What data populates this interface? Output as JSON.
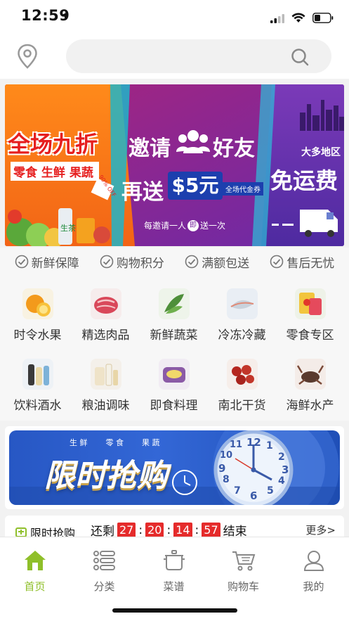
{
  "status_bar": {
    "time": "12:59"
  },
  "header": {
    "search": {
      "placeholder": ""
    }
  },
  "banner": {
    "left_title": "全场九折",
    "left_tags": "零食 生鲜 果蔬",
    "left_ribbon": "90% OFF",
    "product_label": "生茶",
    "center_invite": "邀请",
    "center_friends": "好友",
    "center_again": "再送",
    "center_amount": "$5元",
    "center_coupon": "全场代金券",
    "center_rule_a": "每邀请一人",
    "center_rule_b": "即",
    "center_rule_c": "送一次",
    "right_region": "大多地区",
    "right_free": "免运费"
  },
  "guarantees": [
    "新鲜保障",
    "购物积分",
    "满额包送",
    "售后无忧"
  ],
  "categories": [
    {
      "label": "时令水果",
      "icon": "fruit-icon"
    },
    {
      "label": "精选肉品",
      "icon": "meat-icon"
    },
    {
      "label": "新鲜蔬菜",
      "icon": "vegetable-icon"
    },
    {
      "label": "冷冻冷藏",
      "icon": "frozen-icon"
    },
    {
      "label": "零食专区",
      "icon": "snack-icon"
    },
    {
      "label": "饮料酒水",
      "icon": "drinks-icon"
    },
    {
      "label": "粮油调味",
      "icon": "grain-oil-icon"
    },
    {
      "label": "即食料理",
      "icon": "ready-meal-icon"
    },
    {
      "label": "南北干货",
      "icon": "dried-goods-icon"
    },
    {
      "label": "海鲜水产",
      "icon": "seafood-icon"
    }
  ],
  "flash_banner": {
    "tag1": "生 鲜",
    "tag2": "零 食",
    "tag3": "果 蔬",
    "title": "限时抢购",
    "clock_numbers": [
      "12",
      "1",
      "2",
      "3",
      "4",
      "5",
      "6",
      "7",
      "8",
      "9",
      "10",
      "11"
    ]
  },
  "flash_sale": {
    "title": "限时抢购",
    "remaining": "还剩",
    "hours": "27",
    "minutes": "20",
    "seconds": "14",
    "ms": "57",
    "ended_label": "结束",
    "more": "更多>"
  },
  "tabs": [
    {
      "label": "首页",
      "icon": "home-icon",
      "active": true
    },
    {
      "label": "分类",
      "icon": "category-list-icon",
      "active": false
    },
    {
      "label": "菜谱",
      "icon": "cooking-pot-icon",
      "active": false
    },
    {
      "label": "购物车",
      "icon": "cart-icon",
      "active": false
    },
    {
      "label": "我的",
      "icon": "user-icon",
      "active": false
    }
  ],
  "colors": {
    "accent": "#8fbf2a",
    "countdown": "#e52b2b",
    "banner_blue": "#2a5ac8"
  }
}
